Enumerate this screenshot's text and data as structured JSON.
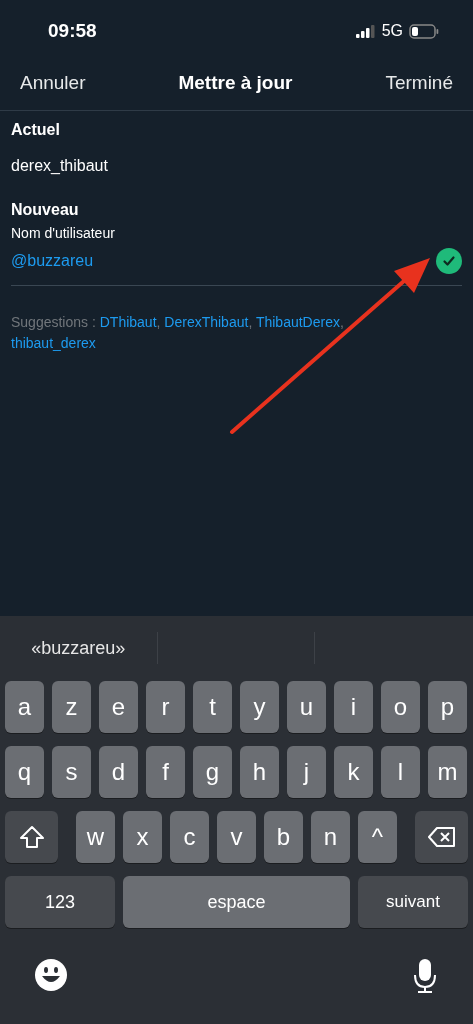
{
  "status_bar": {
    "time": "09:58",
    "network": "5G"
  },
  "nav": {
    "cancel": "Annuler",
    "title": "Mettre à jour",
    "done": "Terminé"
  },
  "current": {
    "heading": "Actuel",
    "value": "derex_thibaut"
  },
  "new": {
    "heading": "Nouveau",
    "label": "Nom d'utilisateur",
    "value": "@buzzareu",
    "available": true
  },
  "suggestions": {
    "label": "Suggestions :",
    "separator": ",",
    "names": [
      "DThibaut",
      "DerexThibaut",
      "ThibautDerex",
      "thibaut_derex"
    ]
  },
  "keyboard": {
    "predictions": [
      "«buzzareu»"
    ],
    "rows": [
      {
        "keys": [
          {
            "kind": "letter",
            "label": "a"
          },
          {
            "kind": "letter",
            "label": "z"
          },
          {
            "kind": "letter",
            "label": "e"
          },
          {
            "kind": "letter",
            "label": "r"
          },
          {
            "kind": "letter",
            "label": "t"
          },
          {
            "kind": "letter",
            "label": "y"
          },
          {
            "kind": "letter",
            "label": "u"
          },
          {
            "kind": "letter",
            "label": "i"
          },
          {
            "kind": "letter",
            "label": "o"
          },
          {
            "kind": "letter",
            "label": "p"
          }
        ]
      },
      {
        "keys": [
          {
            "kind": "letter",
            "label": "q"
          },
          {
            "kind": "letter",
            "label": "s"
          },
          {
            "kind": "letter",
            "label": "d"
          },
          {
            "kind": "letter",
            "label": "f"
          },
          {
            "kind": "letter",
            "label": "g"
          },
          {
            "kind": "letter",
            "label": "h"
          },
          {
            "kind": "letter",
            "label": "j"
          },
          {
            "kind": "letter",
            "label": "k"
          },
          {
            "kind": "letter",
            "label": "l"
          },
          {
            "kind": "letter",
            "label": "m"
          }
        ]
      },
      {
        "keys": [
          {
            "kind": "shift"
          },
          {
            "kind": "letter",
            "label": "w"
          },
          {
            "kind": "letter",
            "label": "x"
          },
          {
            "kind": "letter",
            "label": "c"
          },
          {
            "kind": "letter",
            "label": "v"
          },
          {
            "kind": "letter",
            "label": "b"
          },
          {
            "kind": "letter",
            "label": "n"
          },
          {
            "kind": "letter",
            "label": "^"
          },
          {
            "kind": "delete"
          }
        ]
      },
      {
        "keys": [
          {
            "kind": "numbers",
            "label": "123"
          },
          {
            "kind": "space",
            "label": "espace"
          },
          {
            "kind": "action",
            "label": "suivant"
          }
        ]
      }
    ]
  }
}
